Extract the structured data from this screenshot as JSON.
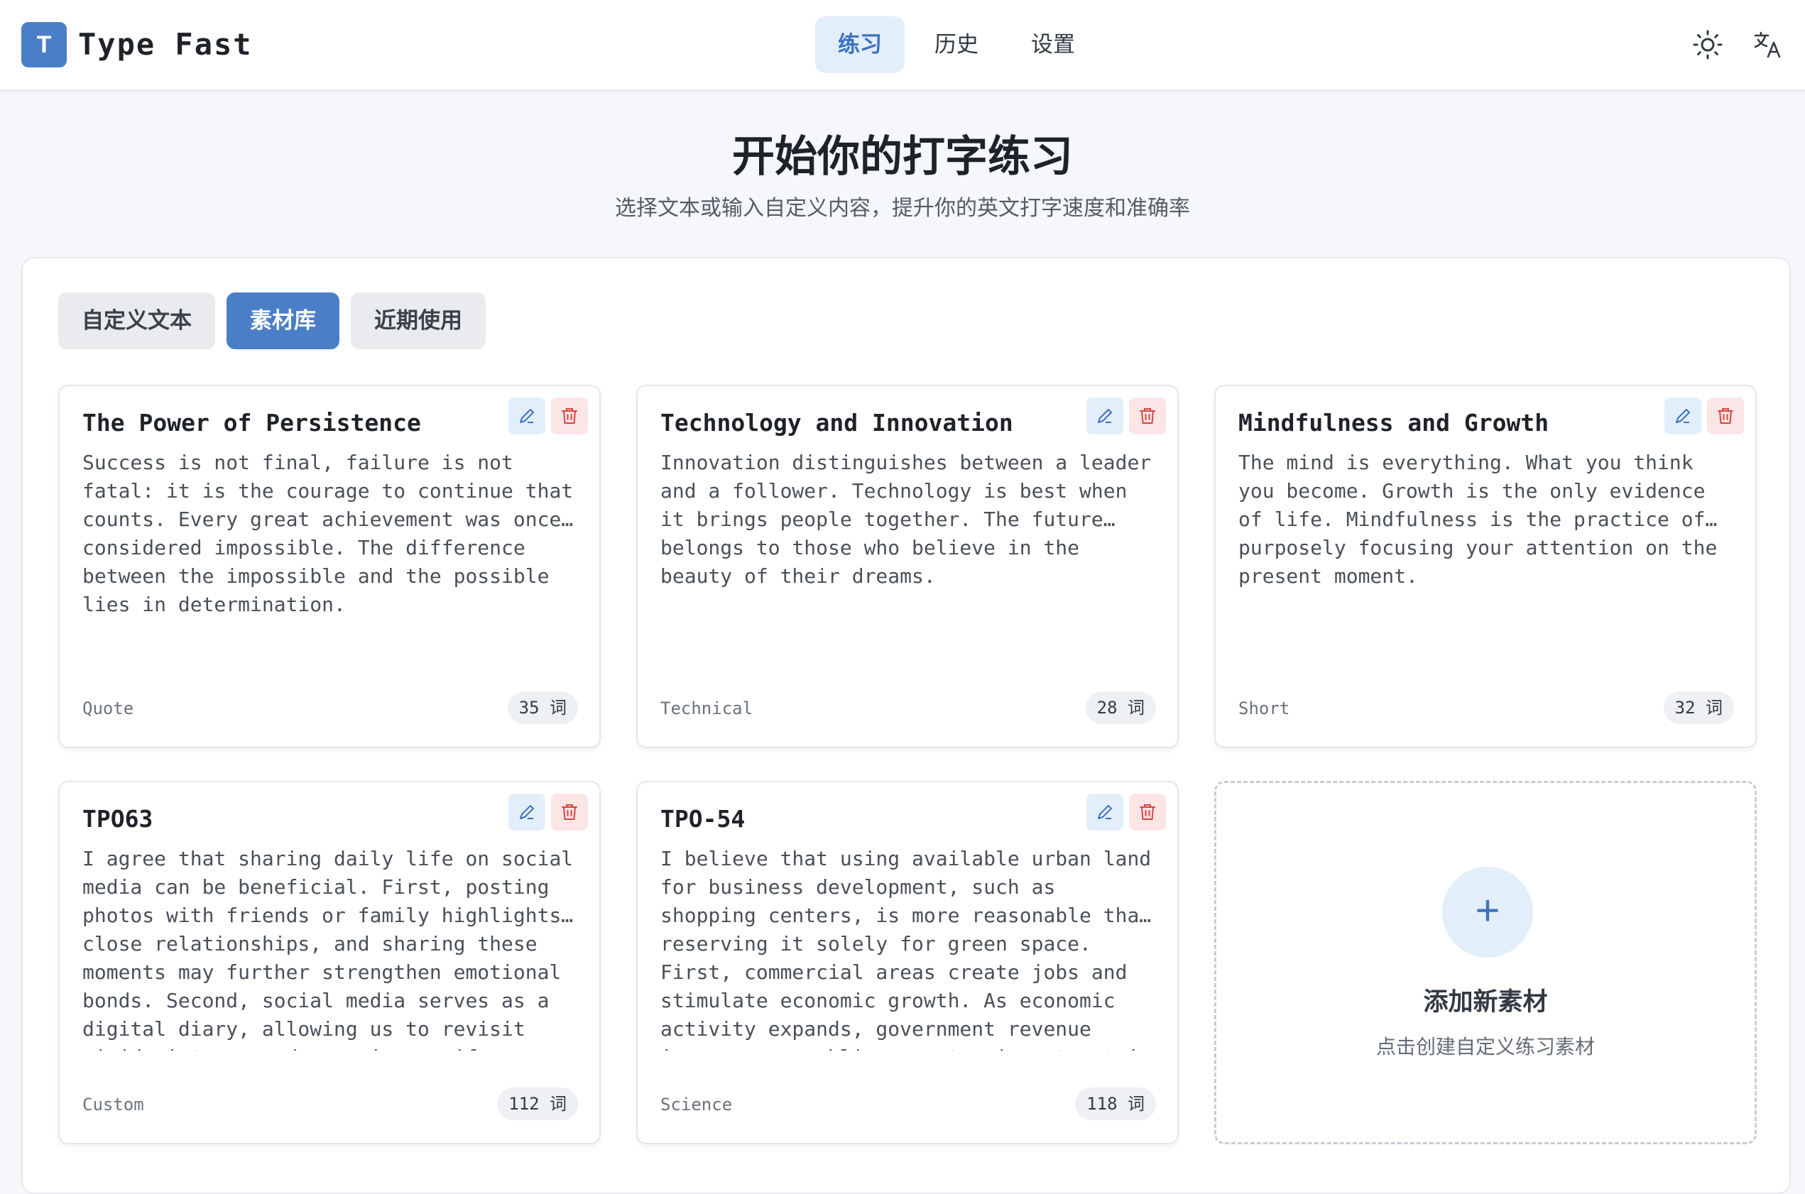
{
  "app": {
    "logo_letter": "T",
    "title": "Type Fast"
  },
  "nav": {
    "items": [
      {
        "label": "练习",
        "active": true
      },
      {
        "label": "历史",
        "active": false
      },
      {
        "label": "设置",
        "active": false
      }
    ]
  },
  "header_icons": [
    "sun-icon",
    "translate-icon"
  ],
  "hero": {
    "title": "开始你的打字练习",
    "subtitle": "选择文本或输入自定义内容，提升你的英文打字速度和准确率"
  },
  "tabs": [
    {
      "label": "自定义文本",
      "active": false
    },
    {
      "label": "素材库",
      "active": true
    },
    {
      "label": "近期使用",
      "active": false
    }
  ],
  "cards": [
    {
      "title": "The Power of Persistence",
      "body": "Success is not final, failure is not\nfatal: it is the courage to continue that\ncounts. Every great achievement was once…\nconsidered impossible. The difference\nbetween the impossible and the possible\nlies in determination.",
      "tag": "Quote",
      "count": "35 词"
    },
    {
      "title": "Technology and Innovation",
      "body": "Innovation distinguishes between a leader\nand a follower. Technology is best when\nit brings people together. The future…\nbelongs to those who believe in the\nbeauty of their dreams.",
      "tag": "Technical",
      "count": "28 词"
    },
    {
      "title": "Mindfulness and Growth",
      "body": "The mind is everything. What you think\nyou become. Growth is the only evidence\nof life. Mindfulness is the practice of…\npurposely focusing your attention on the\npresent moment.",
      "tag": "Short",
      "count": "32 词"
    },
    {
      "title": "TPO63",
      "body": "I agree that sharing daily life on social\nmedia can be beneficial. First, posting\nphotos with friends or family highlights…\nclose relationships, and sharing these\nmoments may further strengthen emotional\nbonds. Second, social media serves as a\ndigital diary, allowing us to revisit\nvivid pictures and memories as if we were",
      "tag": "Custom",
      "count": "112 词"
    },
    {
      "title": "TPO-54",
      "body": "I believe that using available urban land\nfor business development, such as\nshopping centers, is more reasonable tha…\nreserving it solely for green space.\nFirst, commercial areas create jobs and\nstimulate economic growth. As economic\nactivity expands, government revenue\nincreases, enabling greater investment in",
      "tag": "Science",
      "count": "118 词"
    }
  ],
  "add_card": {
    "plus": "+",
    "title": "添加新素材",
    "subtitle": "点击创建自定义练习素材"
  },
  "colors": {
    "accent": "#4a7fc7",
    "accent_light": "#e3eefb",
    "danger": "#d64545",
    "danger_light": "#fbe5e5"
  }
}
